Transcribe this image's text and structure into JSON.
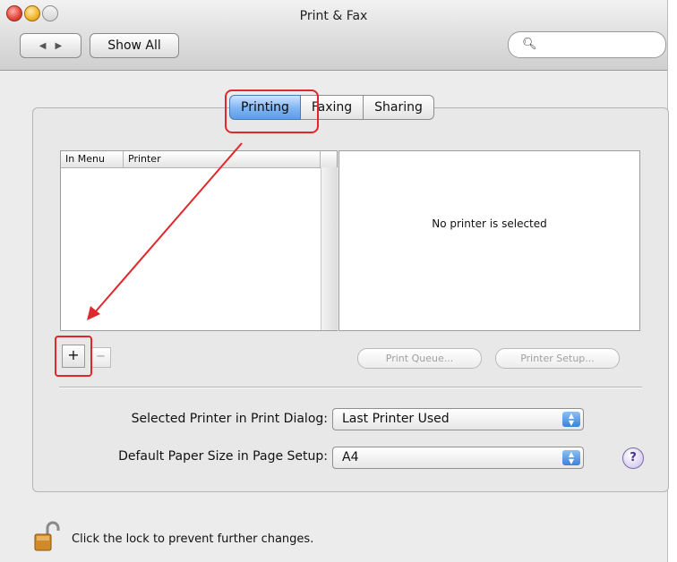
{
  "window": {
    "title": "Print & Fax"
  },
  "toolbar": {
    "back_label": "◀",
    "forward_label": "▶",
    "show_all_label": "Show All",
    "search_placeholder": ""
  },
  "tabs": [
    {
      "label": "Printing",
      "active": true
    },
    {
      "label": "Faxing",
      "active": false
    },
    {
      "label": "Sharing",
      "active": false
    }
  ],
  "printer_list": {
    "columns": [
      "In Menu",
      "Printer"
    ],
    "rows": []
  },
  "detail": {
    "message": "No printer is selected"
  },
  "list_buttons": {
    "add_label": "+",
    "remove_label": "−"
  },
  "actions": {
    "print_queue_label": "Print Queue...",
    "printer_setup_label": "Printer Setup..."
  },
  "settings": {
    "selected_printer_label": "Selected Printer in Print Dialog:",
    "selected_printer_value": "Last Printer Used",
    "paper_size_label": "Default Paper Size in Page Setup:",
    "paper_size_value": "A4"
  },
  "help_label": "?",
  "lock": {
    "message": "Click the lock to prevent further changes."
  },
  "colors": {
    "annotation": "#e0282c",
    "tab_active": "#5b9de6"
  },
  "icons": {
    "search": "search-icon",
    "lock": "lock-icon",
    "help": "help-icon"
  }
}
